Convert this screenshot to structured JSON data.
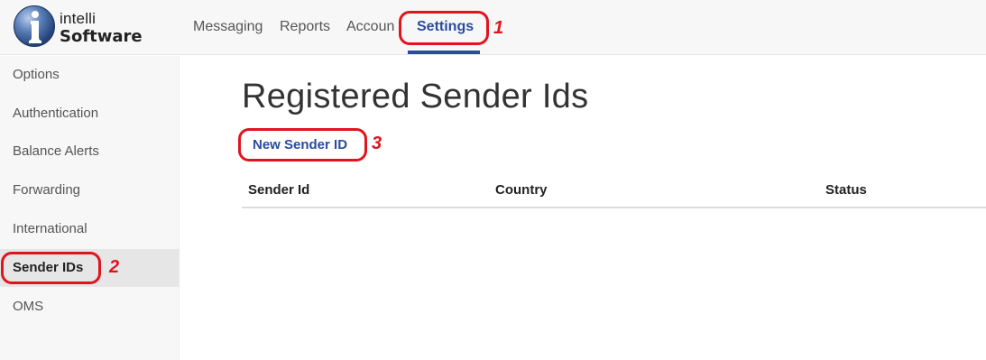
{
  "header": {
    "logo": {
      "line1": "intelli",
      "line2": "Software"
    },
    "nav": [
      {
        "label": "Messaging"
      },
      {
        "label": "Reports"
      },
      {
        "label": "Accoun"
      },
      {
        "label": "Settings"
      }
    ]
  },
  "sidebar": {
    "items": [
      {
        "label": "Options"
      },
      {
        "label": "Authentication"
      },
      {
        "label": "Balance Alerts"
      },
      {
        "label": "Forwarding"
      },
      {
        "label": "International"
      },
      {
        "label": "Sender IDs"
      },
      {
        "label": "OMS"
      }
    ]
  },
  "main": {
    "title": "Registered Sender Ids",
    "new_button": "New Sender ID",
    "table": {
      "columns": [
        "Sender Id",
        "Country",
        "Status"
      ]
    }
  },
  "annotations": [
    "1",
    "2",
    "3"
  ],
  "colors": {
    "accent": "#2b4c9c",
    "annotation": "#e0141e"
  }
}
